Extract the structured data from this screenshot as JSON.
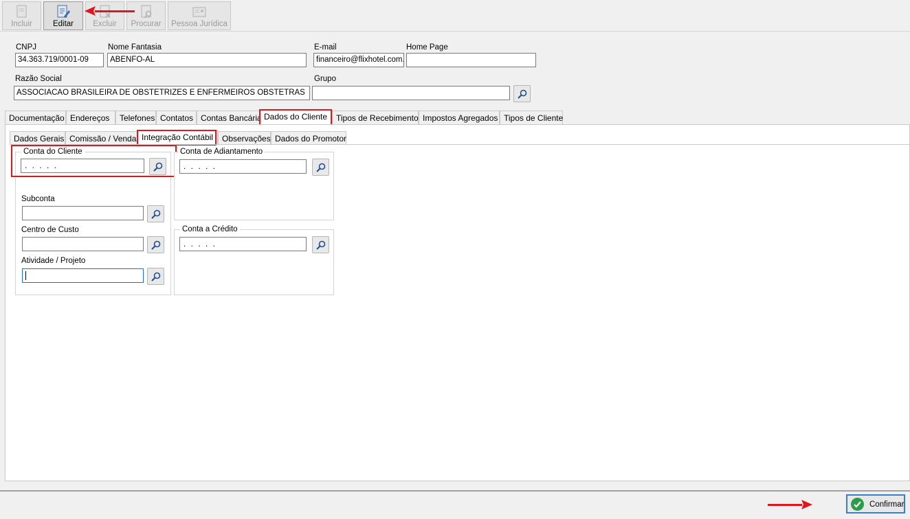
{
  "toolbar": {
    "buttons": [
      {
        "label": "Incluir",
        "enabled": false,
        "icon": "new-document-icon"
      },
      {
        "label": "Editar",
        "enabled": true,
        "icon": "edit-document-icon"
      },
      {
        "label": "Excluir",
        "enabled": false,
        "icon": "delete-document-icon"
      },
      {
        "label": "Procurar",
        "enabled": false,
        "icon": "search-document-icon"
      },
      {
        "label": "Pessoa Jurídica",
        "enabled": false,
        "icon": "company-card-icon"
      }
    ]
  },
  "header": {
    "cnpj": {
      "label": "CNPJ",
      "value": "34.363.719/0001-09"
    },
    "nome_fantasia": {
      "label": "Nome Fantasia",
      "value": "ABENFO-AL"
    },
    "email": {
      "label": "E-mail",
      "value": "financeiro@flixhotel.com.b"
    },
    "home_page": {
      "label": "Home Page",
      "value": ""
    },
    "razao_social": {
      "label": "Razão Social",
      "value": "ASSOCIACAO BRASILEIRA DE OBSTETRIZES E ENFERMEIROS OBSTETRAS"
    },
    "grupo": {
      "label": "Grupo",
      "value": ""
    }
  },
  "main_tabs": [
    "Documentação",
    "Endereços",
    "Telefones",
    "Contatos",
    "Contas Bancárias",
    "Dados do Cliente",
    "Tipos de Recebimento",
    "Impostos Agregados",
    "Tipos de Cliente"
  ],
  "main_tab_selected": "Dados do Cliente",
  "sub_tabs": [
    "Dados Gerais",
    "Comissão / Vendas",
    "Integração Contábil",
    "Observações",
    "Dados do Promotor"
  ],
  "sub_tab_selected": "Integração Contábil",
  "integracao": {
    "conta_cliente": {
      "label": "Conta do Cliente",
      "value": ". . . . ."
    },
    "subconta": {
      "label": "Subconta",
      "value": ""
    },
    "centro_custo": {
      "label": "Centro de Custo",
      "value": ""
    },
    "atividade_projeto": {
      "label": "Atividade / Projeto",
      "value": ""
    },
    "conta_adiantamento": {
      "label": "Conta de Adiantamento",
      "value": ". . . . ."
    },
    "conta_credito": {
      "label": "Conta a Crédito",
      "value": ". . . . ."
    }
  },
  "footer": {
    "confirm_label": "Confirmar"
  },
  "colors": {
    "highlight": "#e0161e",
    "confirm_border": "#3a7fc4",
    "confirm_check": "#2d9b4a"
  }
}
